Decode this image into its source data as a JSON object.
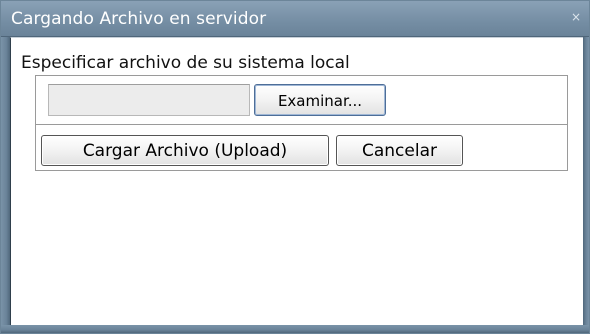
{
  "dialog": {
    "title": "Cargando Archivo en servidor",
    "close_icon": "close-icon",
    "close_glyph": "×"
  },
  "form": {
    "instruction": "Especificar archivo de su sistema local",
    "file_input_value": "",
    "browse_label": "Examinar...",
    "upload_label": "Cargar Archivo (Upload)",
    "cancel_label": "Cancelar"
  },
  "colors": {
    "titlebar": "#768fa5",
    "frame": "#6a8399",
    "content_background": "#ffffff",
    "file_input_background": "#ececec"
  }
}
